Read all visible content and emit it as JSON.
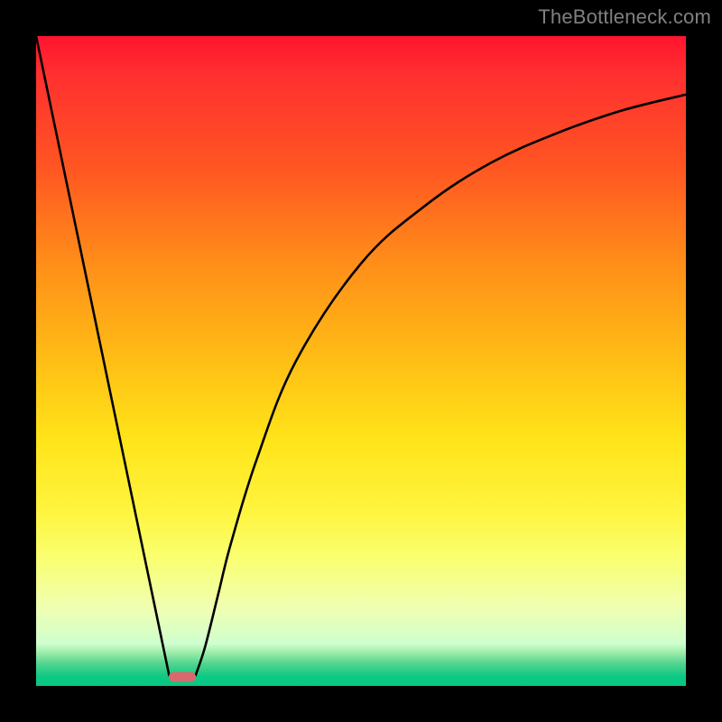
{
  "credit_text": "TheBottleneck.com",
  "colors": {
    "frame": "#000000",
    "curve": "#000000",
    "pill": "#d86a6e",
    "credit": "#808080"
  },
  "chart_data": {
    "type": "line",
    "title": "",
    "xlabel": "",
    "ylabel": "",
    "xlim": [
      0,
      100
    ],
    "ylim": [
      0,
      100
    ],
    "series": [
      {
        "name": "left-descent",
        "x": [
          0,
          20.5
        ],
        "values": [
          100,
          1.5
        ]
      },
      {
        "name": "right-curve",
        "x": [
          24.5,
          26,
          28,
          30,
          34,
          40,
          50,
          60,
          70,
          80,
          90,
          100
        ],
        "values": [
          1.5,
          6,
          14,
          22,
          35,
          50,
          65,
          74,
          80.5,
          85,
          88.5,
          91
        ]
      }
    ],
    "marker": {
      "name": "minimum-pill",
      "x": 22.5,
      "y": 1.4
    },
    "grid": false,
    "legend": false
  }
}
